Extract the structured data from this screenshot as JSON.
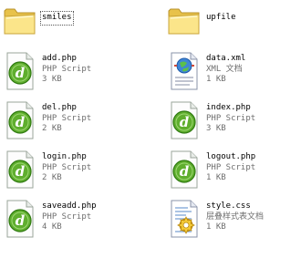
{
  "files": [
    {
      "icon": "folder-icon",
      "name": "smiles",
      "line2": "",
      "line3": "",
      "selected": true
    },
    {
      "icon": "folder-icon",
      "name": "upfile",
      "line2": "",
      "line3": ""
    },
    {
      "icon": "dreamweaver-php-icon",
      "name": "add.php",
      "line2": "PHP Script",
      "line3": "3 KB"
    },
    {
      "icon": "xml-document-icon",
      "name": "data.xml",
      "line2": "XML 文档",
      "line3": "1 KB"
    },
    {
      "icon": "dreamweaver-php-icon",
      "name": "del.php",
      "line2": "PHP Script",
      "line3": "2 KB"
    },
    {
      "icon": "dreamweaver-php-icon",
      "name": "index.php",
      "line2": "PHP Script",
      "line3": "3 KB"
    },
    {
      "icon": "dreamweaver-php-icon",
      "name": "login.php",
      "line2": "PHP Script",
      "line3": "2 KB"
    },
    {
      "icon": "dreamweaver-php-icon",
      "name": "logout.php",
      "line2": "PHP Script",
      "line3": "1 KB"
    },
    {
      "icon": "dreamweaver-php-icon",
      "name": "saveadd.php",
      "line2": "PHP Script",
      "line3": "4 KB"
    },
    {
      "icon": "css-document-icon",
      "name": "style.css",
      "line2": "层叠样式表文档",
      "line3": "1 KB"
    }
  ],
  "colors": {
    "folder_light": "#fbe58a",
    "folder_dark": "#e8c24a",
    "dw_green": "#5fae2e",
    "dw_green_dark": "#2f7a10",
    "secondary_text": "#6e6e6e"
  }
}
